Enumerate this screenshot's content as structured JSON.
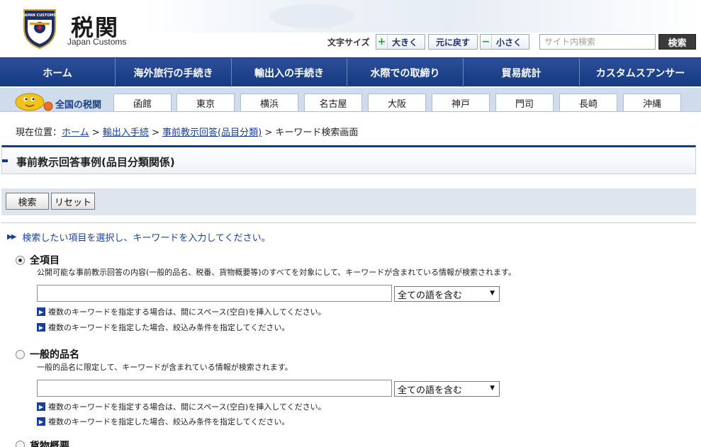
{
  "header": {
    "logo_title": "税関",
    "logo_subtitle": "Japan Customs",
    "emblem_text": "JAPAN CUSTOMS",
    "font_size": {
      "label": "文字サイズ",
      "larger": "大きく",
      "reset": "元に戻す",
      "smaller": "小さく"
    },
    "search": {
      "placeholder": "サイト内検索",
      "button_label": "検索"
    }
  },
  "main_nav": [
    {
      "label": "ホーム"
    },
    {
      "label": "海外旅行の手続き"
    },
    {
      "label": "輸出入の手続き"
    },
    {
      "label": "水際での取締り"
    },
    {
      "label": "貿易統計"
    },
    {
      "label": "カスタムスアンサー"
    }
  ],
  "sub_nav": {
    "label": "全国の税関",
    "branches": [
      "函館",
      "東京",
      "横浜",
      "名古屋",
      "大阪",
      "神戸",
      "門司",
      "長崎",
      "沖縄"
    ]
  },
  "breadcrumb": {
    "prefix": "現在位置：",
    "links": [
      "ホーム",
      "輸出入手続",
      "事前教示回答(品目分類)"
    ],
    "separator": ">",
    "current": "キーワード検索画面"
  },
  "page": {
    "title": "事前教示回答事例(品目分類関係)",
    "actions": {
      "search_label": "検索",
      "reset_label": "リセット"
    },
    "instruction": "検索したい項目を選択し、キーワードを入力してください。",
    "options": [
      {
        "title": "全項目",
        "checked": true,
        "description": "公開可能な事前教示回答の内容(一般的品名、税番、貨物概要等)のすべてを対象にして、キーワードが含まれている情報が検索されます。",
        "select_value": "全ての語を含む",
        "notes": [
          "複数のキーワードを指定する場合は、間にスペース(空白)を挿入してください。",
          "複数のキーワードを指定した場合、絞込み条件を指定してください。"
        ]
      },
      {
        "title": "一般的品名",
        "checked": false,
        "description": "一般的品名に限定して、キーワードが含まれている情報が検索されます。",
        "select_value": "全ての語を含む",
        "notes": [
          "複数のキーワードを指定する場合は、間にスペース(空白)を挿入してください。",
          "複数のキーワードを指定した場合、絞込み条件を指定してください。"
        ]
      },
      {
        "title": "貨物概要",
        "checked": false
      }
    ]
  },
  "colors": {
    "nav_blue": "#163a80",
    "subnav_bg": "#cfdcec",
    "link_blue": "#1a3f9a",
    "action_bar_bg": "#dfe5ee"
  }
}
